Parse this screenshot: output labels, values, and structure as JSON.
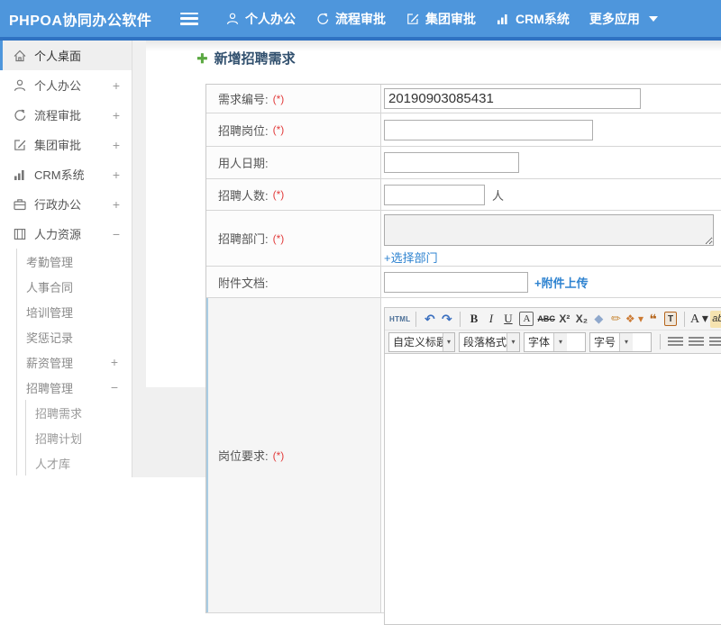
{
  "topbar": {
    "logo": "PHPOA协同办公软件",
    "nav": [
      {
        "label": "个人办公",
        "icon": "user-icon"
      },
      {
        "label": "流程审批",
        "icon": "process-icon"
      },
      {
        "label": "集团审批",
        "icon": "edit-icon"
      },
      {
        "label": "CRM系统",
        "icon": "chart-icon"
      },
      {
        "label": "更多应用",
        "icon": "caret-down-icon"
      }
    ]
  },
  "sidebar": {
    "l1": [
      {
        "label": "个人桌面",
        "exp": ""
      },
      {
        "label": "个人办公",
        "exp": "+"
      },
      {
        "label": "流程审批",
        "exp": "+"
      },
      {
        "label": "集团审批",
        "exp": "+"
      },
      {
        "label": "CRM系统",
        "exp": "+"
      },
      {
        "label": "行政办公",
        "exp": "+"
      },
      {
        "label": "人力资源",
        "exp": "−"
      }
    ],
    "l2": [
      {
        "label": "考勤管理",
        "exp": ""
      },
      {
        "label": "人事合同",
        "exp": ""
      },
      {
        "label": "培训管理",
        "exp": ""
      },
      {
        "label": "奖惩记录",
        "exp": ""
      },
      {
        "label": "薪资管理",
        "exp": "+"
      },
      {
        "label": "招聘管理",
        "exp": "−"
      }
    ],
    "l3": [
      {
        "label": "招聘需求"
      },
      {
        "label": "招聘计划"
      },
      {
        "label": "人才库"
      }
    ]
  },
  "main": {
    "title": "新增招聘需求",
    "title_icon": "plus-icon",
    "form": {
      "rows": [
        {
          "label": "需求编号:",
          "req": "(*)"
        },
        {
          "label": "招聘岗位:",
          "req": "(*)"
        },
        {
          "label": "用人日期:",
          "req": ""
        },
        {
          "label": "招聘人数:",
          "req": "(*)",
          "suffix": "人"
        },
        {
          "label": "招聘部门:",
          "req": "(*)",
          "link": "+选择部门"
        },
        {
          "label": "附件文档:",
          "req": "",
          "link": "+附件上传"
        },
        {
          "label": "岗位要求:",
          "req": "(*)"
        }
      ],
      "demand_no_value": "20190903085431"
    },
    "editor": {
      "toolbar1": [
        "HTML",
        "↶",
        "↷",
        "B",
        "I",
        "U",
        "A",
        "ABC",
        "X²",
        "X₂",
        "◆",
        "✏",
        "❖ ▾",
        "❝",
        "T",
        "A ▾",
        "ab"
      ],
      "toolbar2": [
        "自定义标题",
        "段落格式",
        "字体",
        "字号"
      ],
      "align_icons": [
        "align-left-icon",
        "align-center-icon",
        "align-right-icon",
        "align-justify-icon"
      ]
    }
  },
  "colors": {
    "topbar_blue": "#4e96dc",
    "topbar_dark_strip": "#2f72c2",
    "sidebar_active_border": "#4e96dc",
    "link_blue": "#2e83d0",
    "required_red": "#e23c3c",
    "title_text": "#31506e"
  }
}
